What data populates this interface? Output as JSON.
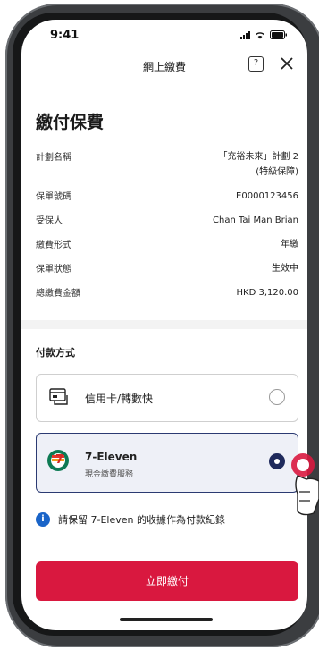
{
  "status_bar": {
    "time": "9:41"
  },
  "header": {
    "title": "網上繳費",
    "help_icon": "help-icon",
    "close_icon": "close-icon"
  },
  "page_title": "繳付保費",
  "policy_info": [
    {
      "label": "計劃名稱",
      "value": "「充裕未來」計劃 2",
      "value2": "(特級保障)"
    },
    {
      "label": "保單號碼",
      "value": "E0000123456"
    },
    {
      "label": "受保人",
      "value": "Chan Tai Man Brian"
    },
    {
      "label": "繳費形式",
      "value": "年繳"
    },
    {
      "label": "保單狀態",
      "value": "生效中"
    },
    {
      "label": "總繳費金額",
      "value": "HKD 3,120.00"
    }
  ],
  "payment": {
    "section_title": "付款方式",
    "options": [
      {
        "label": "信用卡/轉數快",
        "icon": "card-terminal-icon",
        "selected": false
      },
      {
        "label": "7-Eleven",
        "sub": "現金繳費服務",
        "icon": "seven-eleven-logo",
        "selected": true
      }
    ]
  },
  "notice": "請保留 7-Eleven 的收據作為付款紀錄",
  "pay_button": "立即繳付",
  "colors": {
    "accent": "#d9183f",
    "selected_border": "#2b3a72",
    "info_blue": "#1a64c8"
  }
}
